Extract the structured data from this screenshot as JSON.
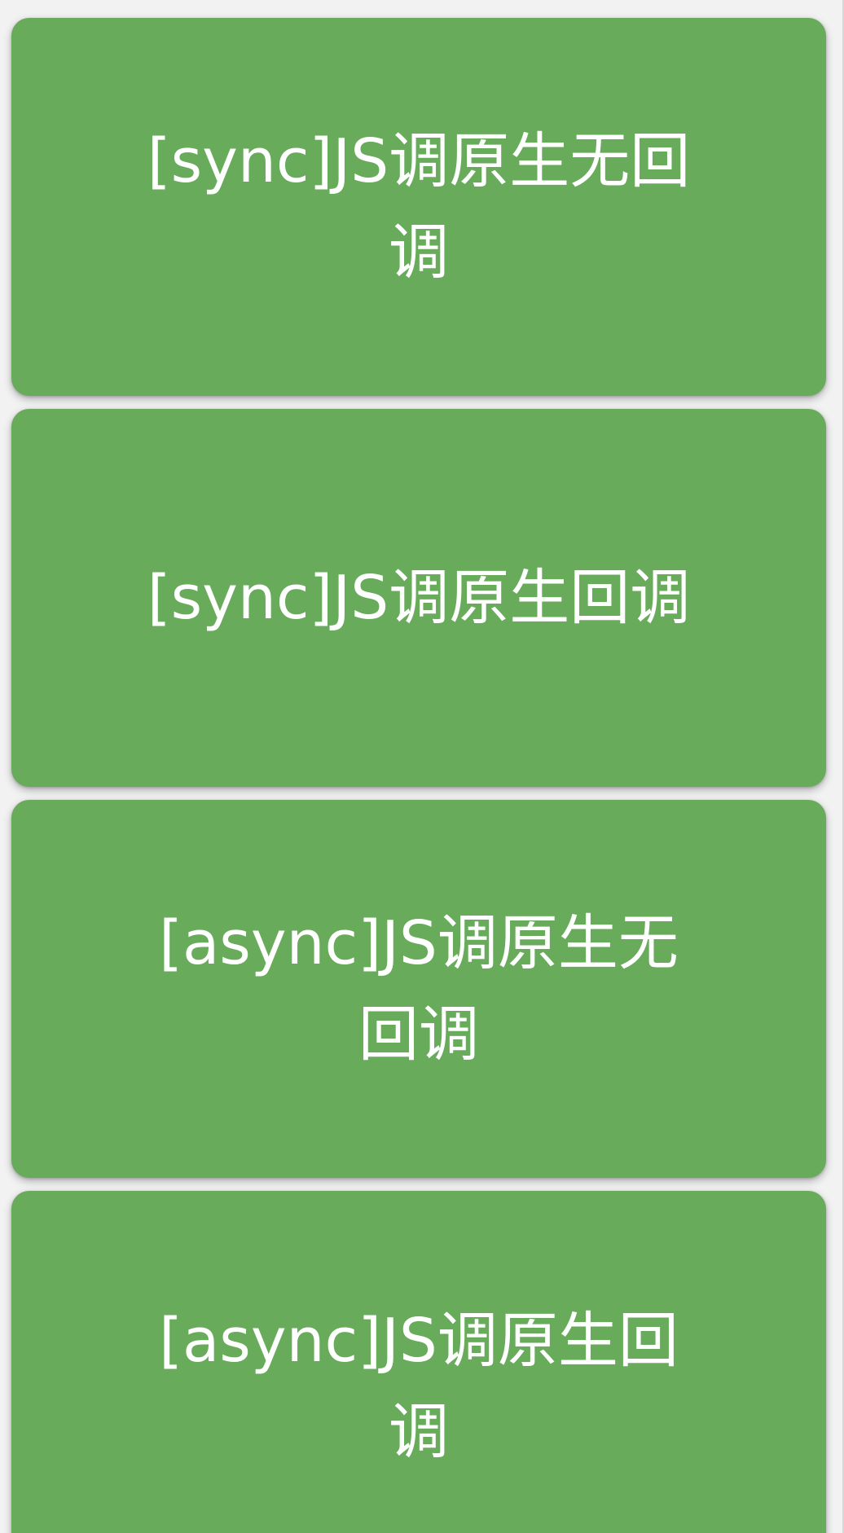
{
  "buttons": [
    {
      "label": "[sync]JS调原生无回调"
    },
    {
      "label": "[sync]JS调原生回调"
    },
    {
      "label": "[async]JS调原生无回调"
    },
    {
      "label": "[async]JS调原生回调"
    }
  ],
  "colors": {
    "button_bg": "#67ab5b",
    "button_text": "#ffffff",
    "page_bg": "#f2f2f2"
  }
}
